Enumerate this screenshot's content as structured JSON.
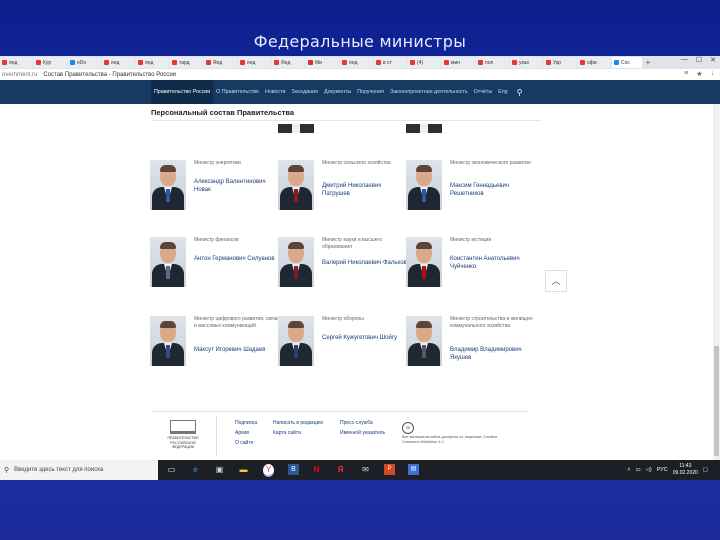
{
  "slide": {
    "title": "Федеральные министры"
  },
  "browser": {
    "tabs": [
      {
        "label": "янд",
        "color": "#e53935"
      },
      {
        "label": "Кур",
        "color": "#e53935"
      },
      {
        "label": "eDo",
        "color": "#1e88e5"
      },
      {
        "label": "янд",
        "color": "#e53935"
      },
      {
        "label": "янд",
        "color": "#e53935"
      },
      {
        "label": "тард",
        "color": "#e53935"
      },
      {
        "label": "Янд",
        "color": "#e53935"
      },
      {
        "label": "янд",
        "color": "#e53935"
      },
      {
        "label": "Янд",
        "color": "#e53935"
      },
      {
        "label": "Ми",
        "color": "#d32f2f"
      },
      {
        "label": "янд",
        "color": "#e53935"
      },
      {
        "label": "в ст",
        "color": "#e53935"
      },
      {
        "label": "(4)",
        "color": "#e53935"
      },
      {
        "label": "мин",
        "color": "#e53935"
      },
      {
        "label": "пол",
        "color": "#e53935"
      },
      {
        "label": "указ",
        "color": "#e53935"
      },
      {
        "label": "Укр",
        "color": "#e53935"
      },
      {
        "label": "офи",
        "color": "#e53935"
      }
    ],
    "active_tab": "Сос",
    "new_tab": "+",
    "address": {
      "url": "overnment.ru",
      "title": "Состав Правительства - Правительство России"
    }
  },
  "site_nav": {
    "items": [
      "Правительство России",
      "О Правительстве",
      "Новости",
      "Заседания",
      "Документы",
      "Поручения",
      "Законопроектная деятельность",
      "Отчёты",
      "Eng"
    ],
    "active_index": 0
  },
  "section": {
    "title": "Персональный состав Правительства"
  },
  "ministers": [
    {
      "role": "Министр энергетики",
      "name": "Александр Валентинович Новак"
    },
    {
      "role": "Министр сельского хозяйства",
      "name": "Дмитрий Николаевич Патрушев"
    },
    {
      "role": "Министр экономического развития",
      "name": "Максим Геннадьевич Решетников"
    },
    {
      "role": "Министр финансов",
      "name": "Антон Германович Силуанов"
    },
    {
      "role": "Министр науки и высшего образования",
      "name": "Валерий Николаевич Фальков"
    },
    {
      "role": "Министр юстиции",
      "name": "Константин Анатольевич Чуйченко"
    },
    {
      "role": "Министр цифрового развития, связи и массовых коммуникаций",
      "name": "Максут Игоревич Шадаев"
    },
    {
      "role": "Министр обороны",
      "name": "Сергей Кужугетович Шойгу"
    },
    {
      "role": "Министр строительства и жилищно-коммунального хозяйства",
      "name": "Владимир Владимирович Якушев"
    }
  ],
  "footer": {
    "logo_text": "ПРАВИТЕЛЬСТВО РОССИЙСКОЙ ФЕДЕРАЦИИ",
    "col1": [
      "Подписка",
      "Архив",
      "О сайте"
    ],
    "col2": [
      "Написать в редакцию",
      "Карта сайта"
    ],
    "col3": [
      "Пресс-служба",
      "Именной указатель"
    ],
    "license": "Все материалы сайта доступны по лицензии: Creative Commons Attribution 4.0",
    "cc": "cc"
  },
  "taskbar": {
    "search_placeholder": "Введите здесь текст для поиска",
    "lang": "РУС",
    "time": "11:43",
    "date": "09.02.2020"
  }
}
